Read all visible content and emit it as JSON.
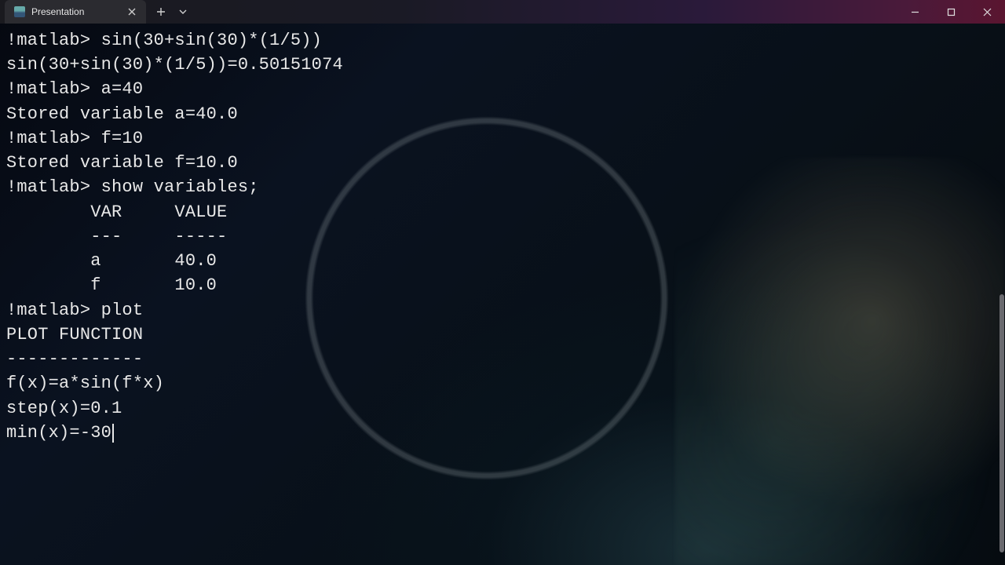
{
  "titlebar": {
    "tab_title": "Presentation",
    "new_tab_tooltip": "+",
    "dropdown_tooltip": "v"
  },
  "terminal": {
    "prompt": "!matlab> ",
    "lines": [
      {
        "kind": "cmd",
        "text": "sin(30+sin(30)*(1/5))"
      },
      {
        "kind": "out",
        "text": "sin(30+sin(30)*(1/5))=0.50151074"
      },
      {
        "kind": "cmd",
        "text": "a=40"
      },
      {
        "kind": "out",
        "text": "Stored variable a=40.0"
      },
      {
        "kind": "cmd",
        "text": "f=10"
      },
      {
        "kind": "out",
        "text": "Stored variable f=10.0"
      },
      {
        "kind": "cmd",
        "text": "show variables;"
      },
      {
        "kind": "out",
        "text": ""
      },
      {
        "kind": "out",
        "text": "        VAR     VALUE"
      },
      {
        "kind": "out",
        "text": "        ---     -----"
      },
      {
        "kind": "out",
        "text": "        a       40.0"
      },
      {
        "kind": "out",
        "text": "        f       10.0"
      },
      {
        "kind": "out",
        "text": ""
      },
      {
        "kind": "cmd",
        "text": "plot"
      },
      {
        "kind": "out",
        "text": ""
      },
      {
        "kind": "out",
        "text": "PLOT FUNCTION"
      },
      {
        "kind": "out",
        "text": "-------------"
      },
      {
        "kind": "out",
        "text": ""
      },
      {
        "kind": "out",
        "text": "f(x)=a*sin(f*x)"
      },
      {
        "kind": "out",
        "text": "step(x)=0.1"
      },
      {
        "kind": "input",
        "text": "min(x)=-30"
      }
    ],
    "variables_table": {
      "headers": [
        "VAR",
        "VALUE"
      ],
      "rows": [
        {
          "var": "a",
          "value": "40.0"
        },
        {
          "var": "f",
          "value": "10.0"
        }
      ]
    }
  }
}
